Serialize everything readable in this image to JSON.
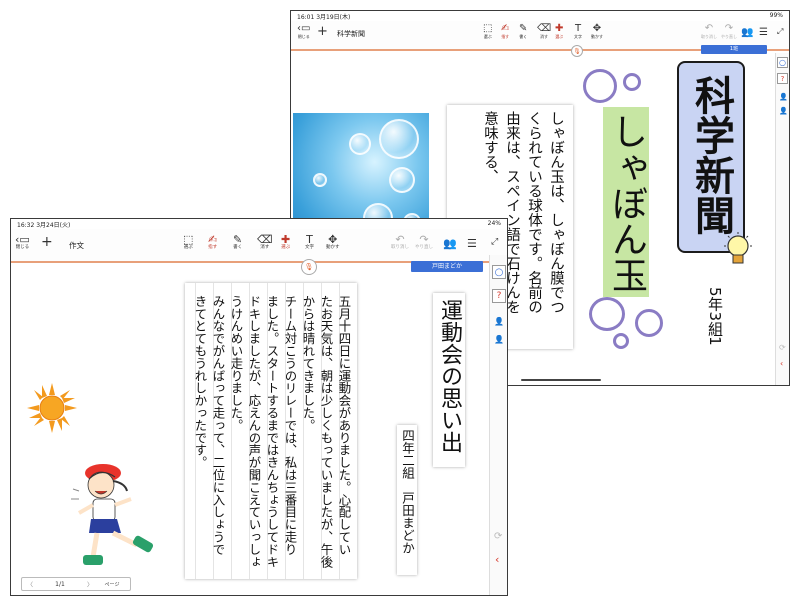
{
  "back_window": {
    "status": {
      "time": "16:01  3月19日(木)",
      "battery": "99%"
    },
    "toolbar": {
      "close_label": "閉じる",
      "add_glyph": "+",
      "doc_title": "科学新聞",
      "tools": [
        {
          "icon": "select-icon",
          "glyph": "⬚",
          "label": "選ぶ"
        },
        {
          "icon": "finger-icon",
          "glyph": "✍",
          "label": "指す"
        },
        {
          "icon": "pen-icon",
          "glyph": "✎",
          "label": "書く"
        },
        {
          "icon": "eraser-icon",
          "glyph": "⌫",
          "label": "消す"
        },
        {
          "icon": "pick-icon",
          "glyph": "✚",
          "label": "選ぶ"
        },
        {
          "icon": "text-icon",
          "glyph": "T",
          "label": "文字"
        },
        {
          "icon": "move-icon",
          "glyph": "✥",
          "label": "動かす"
        }
      ],
      "undo_label": "取り消し",
      "redo_label": "やり直し"
    },
    "name_tag": "1班",
    "mic_glyph": "🎙",
    "title_box": "科学新聞",
    "article_title": "しゃぼん玉",
    "body_lines": [
      "しゃぼん玉は、しゃぼん膜でつ",
      "くられている球体です。名前の",
      "由来は、スペイン語で石けんを",
      "意味する、"
    ],
    "byline": "5年3組1",
    "rail": {
      "circle": "○",
      "question": "?"
    }
  },
  "front_window": {
    "status": {
      "time": "16:32  3月24日(火)",
      "battery": "24%"
    },
    "toolbar": {
      "close_label": "閉じる",
      "add_glyph": "+",
      "doc_title": "作文",
      "tools": [
        {
          "icon": "select-icon",
          "glyph": "⬚",
          "label": "選ぶ"
        },
        {
          "icon": "finger-icon",
          "glyph": "✍",
          "label": "指す"
        },
        {
          "icon": "pen-icon",
          "glyph": "✎",
          "label": "書く"
        },
        {
          "icon": "eraser-icon",
          "glyph": "⌫",
          "label": "消す"
        },
        {
          "icon": "pick-icon",
          "glyph": "✚",
          "label": "選ぶ"
        },
        {
          "icon": "text-icon",
          "glyph": "T",
          "label": "文字"
        },
        {
          "icon": "move-icon",
          "glyph": "✥",
          "label": "動かす"
        }
      ],
      "undo_label": "取り消し",
      "redo_label": "やり直し"
    },
    "name_tag": "戸田まどか",
    "mic_glyph": "🎙",
    "essay_title": "運動会の思い出",
    "byline": "四年二組　戸田まどか",
    "body_lines": [
      "五月十四日に運動会がありました。心配してい",
      "たお天気は、朝は少しくもっていましたが、午後",
      "からは晴れてきました。",
      "チーム対こうのリレーでは、私は三番目に走り",
      "ました。スタートするまではきんちょうしてドキ",
      "ドキしましたが、応えんの声が聞こえていっしょ",
      "うけんめい走りました。",
      "みんなでがんばって走って、二位に入しょうで",
      "きてとてもうれしかったです。"
    ],
    "pager": {
      "prev": "〈",
      "page": "1/1",
      "next": "〉",
      "label": "ページ"
    },
    "rail": {
      "circle": "○",
      "question": "?"
    }
  }
}
